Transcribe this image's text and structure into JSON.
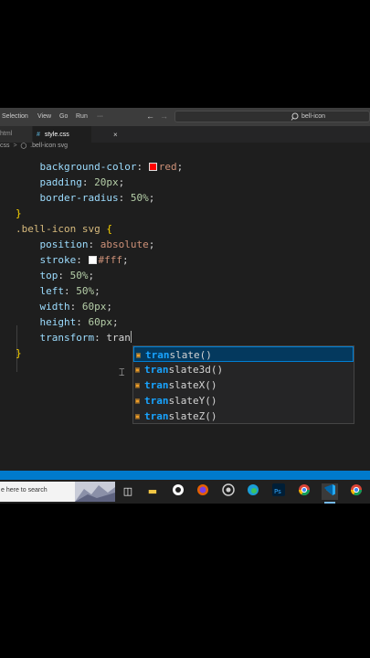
{
  "menu": {
    "items": [
      "Selection",
      "View",
      "Go",
      "Run",
      "···"
    ]
  },
  "nav": {
    "back": "←",
    "forward": "→"
  },
  "command_center": {
    "icon": "search-icon",
    "text": "bell-icon"
  },
  "tabs": [
    {
      "label": "html"
    },
    {
      "label": "style.css",
      "icon_text": "#",
      "close": "×"
    }
  ],
  "breadcrumb": {
    "file": "css",
    "separator": ">",
    "symbol": ".bell-icon svg"
  },
  "code": {
    "l1": {
      "prop": "background-color",
      "colon": ":",
      "swatch": "#ff0000",
      "value": "red",
      "end": ";"
    },
    "l2": {
      "prop": "padding",
      "colon": ":",
      "num": "20px",
      "end": ";"
    },
    "l3": {
      "prop": "border-radius",
      "colon": ":",
      "num": "50%",
      "end": ";"
    },
    "l4": {
      "brace": "}"
    },
    "l5": {
      "selector": ".bell-icon svg",
      "brace": "{"
    },
    "l6": {
      "prop": "position",
      "colon": ":",
      "value": "absolute",
      "end": ";"
    },
    "l7": {
      "prop": "stroke",
      "colon": ":",
      "swatch": "#ffffff",
      "value": "#fff",
      "end": ";"
    },
    "l8": {
      "prop": "top",
      "colon": ":",
      "num": "50%",
      "end": ";"
    },
    "l9": {
      "prop": "left",
      "colon": ":",
      "num": "50%",
      "end": ";"
    },
    "l10": {
      "prop": "width",
      "colon": ":",
      "num": "60px",
      "end": ";"
    },
    "l11": {
      "prop": "height",
      "colon": ":",
      "num": "60px",
      "end": ";"
    },
    "l12": {
      "prop": "transform",
      "colon": ":",
      "typed": "tran"
    },
    "l13": {
      "brace": "}"
    }
  },
  "suggestions": {
    "match": "tran",
    "items": [
      {
        "rest": "slate()",
        "selected": true
      },
      {
        "rest": "slate3d()",
        "selected": false
      },
      {
        "rest": "slateX()",
        "selected": false
      },
      {
        "rest": "slateY()",
        "selected": false
      },
      {
        "rest": "slateZ()",
        "selected": false
      }
    ]
  },
  "taskbar": {
    "search_placeholder": "e here to search",
    "icons": [
      "task-view-icon",
      "file-explorer-icon",
      "app-icon",
      "firefox-icon",
      "obs-icon",
      "edge-icon",
      "photoshop-icon",
      "chrome-icon",
      "vscode-icon",
      "chrome-profile-icon"
    ],
    "ps_label": "Ps"
  },
  "colors": {
    "accent": "#007acc",
    "editor_bg": "#1e1e1e"
  }
}
